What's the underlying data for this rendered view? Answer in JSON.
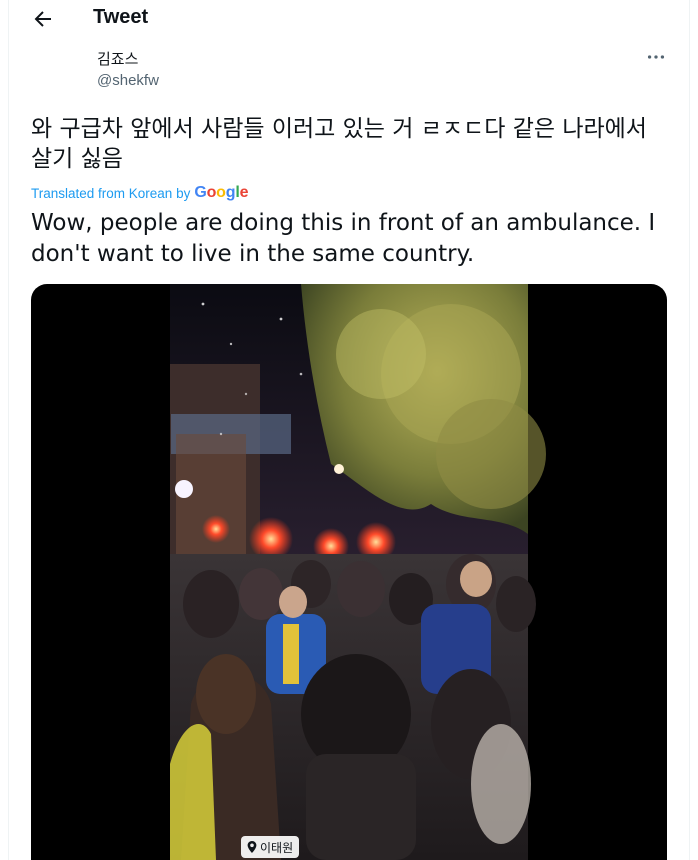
{
  "header": {
    "title": "Tweet"
  },
  "author": {
    "name": "김죠스",
    "handle": "@shekfw"
  },
  "tweet": {
    "original_text": "와 구급차 앞에서 사람들 이러고 있는 거 ㄹㅈㄷ다 같은 나라에서 살기 싫음",
    "translated_label": "Translated from Korean by",
    "translator": "Google",
    "translated_text": "Wow, people are doing this in front of an ambulance. I don't want to live in the same country."
  },
  "media": {
    "location_tag": "이태원"
  },
  "icons": {
    "back": "arrow-left-icon",
    "more": "more-dots-icon",
    "location": "location-pin-icon"
  },
  "colors": {
    "link": "#1d9bf0",
    "secondary_text": "#536471",
    "divider": "#eff3f4"
  }
}
